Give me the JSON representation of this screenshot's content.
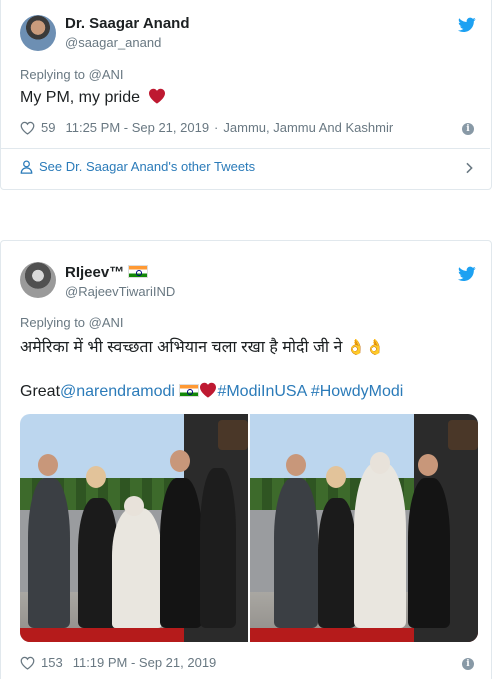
{
  "tweet1": {
    "display_name": "Dr. Saagar Anand",
    "handle": "@saagar_anand",
    "replying_to": "Replying to @ANI",
    "text": "My PM, my pride",
    "text_emoji": "❤️",
    "likes": "59",
    "time_date": "11:25 PM - Sep 21, 2019",
    "separator": "·",
    "location": "Jammu, Jammu And Kashmir",
    "see_more": "See Dr. Saagar Anand's other Tweets"
  },
  "tweet2": {
    "display_name": "RΙjeev™",
    "handle": "@RajeevTiwariIND",
    "replying_to": "Replying to @ANI",
    "text_line1": "अमेरिका में भी स्वच्छता अभियान चला रखा है मोदी जी ने",
    "text_line2_prefix": "Great",
    "mention": "@narendramodi",
    "hashtag1": "#ModiInUSA",
    "hashtag2": "#HowdyModi",
    "likes": "153",
    "time_date": "11:19 PM - Sep 21, 2019"
  },
  "colors": {
    "twitter_blue": "#1da1f2",
    "link_blue": "#2b7bb9",
    "muted_text": "#697882",
    "heart_red": "#e0245e"
  },
  "icons": {
    "bird": "twitter-bird-icon",
    "heart": "heart-outline-icon",
    "info": "info-icon",
    "person": "person-icon",
    "chevron": "chevron-right-icon"
  }
}
